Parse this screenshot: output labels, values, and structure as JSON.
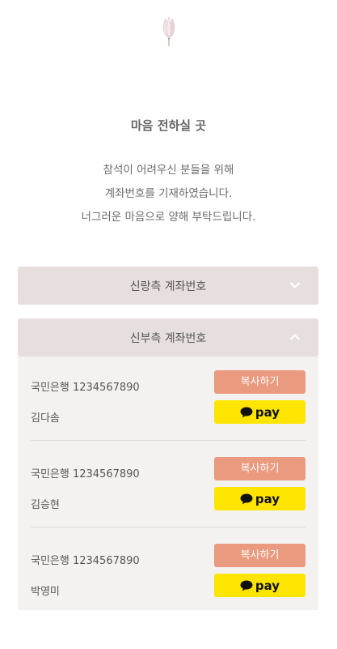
{
  "section": {
    "title": "마음 전하실 곳",
    "message_lines": [
      "참석이 어려우신 분들을 위해",
      "계좌번호를 기재하였습니다.",
      "너그러운 마음으로 양해 부탁드립니다."
    ]
  },
  "groom": {
    "header": "신랑측 계좌번호",
    "expanded": false
  },
  "bride": {
    "header": "신부측 계좌번호",
    "expanded": true,
    "accounts": [
      {
        "bank_number": "국민은행 1234567890",
        "holder": "김다솜",
        "copy_label": "복사하기",
        "pay_label": "pay"
      },
      {
        "bank_number": "국민은행 1234567890",
        "holder": "김승현",
        "copy_label": "복사하기",
        "pay_label": "pay"
      },
      {
        "bank_number": "국민은행 1234567890",
        "holder": "박영미",
        "copy_label": "복사하기",
        "pay_label": "pay"
      }
    ]
  },
  "colors": {
    "header_bg": "#e6dfdd",
    "body_bg": "#f4f2f1",
    "copy_button": "#ea9a7e",
    "kakao_pay": "#fee500"
  },
  "icons": {
    "decoration": "magnolia-flower-icon",
    "collapsed": "chevron-down-icon",
    "expanded": "chevron-up-icon",
    "pay_logo": "kakao-talk-bubble-icon"
  }
}
